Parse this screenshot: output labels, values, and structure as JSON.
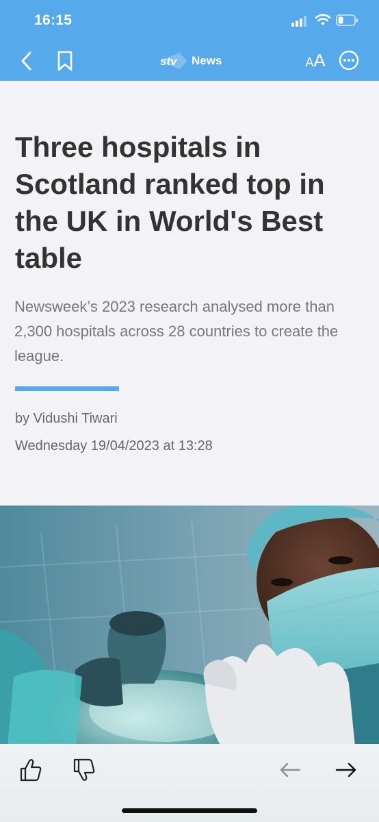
{
  "status_bar": {
    "time": "16:15",
    "signal_icon": "cellular-signal-icon",
    "wifi_icon": "wifi-icon",
    "battery_icon": "battery-low-icon"
  },
  "nav": {
    "back_icon": "chevron-left-icon",
    "bookmark_icon": "bookmark-icon",
    "logo_brand": "stv",
    "logo_section": "News",
    "text_size_small": "A",
    "text_size_large": "A",
    "more_icon": "ellipsis-circle-icon"
  },
  "article": {
    "headline": "Three hospitals in Scotland ranked top in the UK in World's Best table",
    "standfirst": "Newsweek’s 2023 research analysed more than 2,300 hospitals across 28 countries to create the league.",
    "byline": "by Vidushi Tiwari",
    "date": "Wednesday 19/04/2023 at 13:28",
    "hero_image": "surgeon-with-anaesthetic-mask-photo"
  },
  "bottom_bar": {
    "like_icon": "thumbs-up-icon",
    "dislike_icon": "thumbs-down-icon",
    "prev_icon": "arrow-left-icon",
    "next_icon": "arrow-right-icon"
  },
  "colors": {
    "accent": "#56a9ea",
    "headline": "#333333",
    "standfirst": "#777777",
    "background": "#f3f3f7"
  }
}
